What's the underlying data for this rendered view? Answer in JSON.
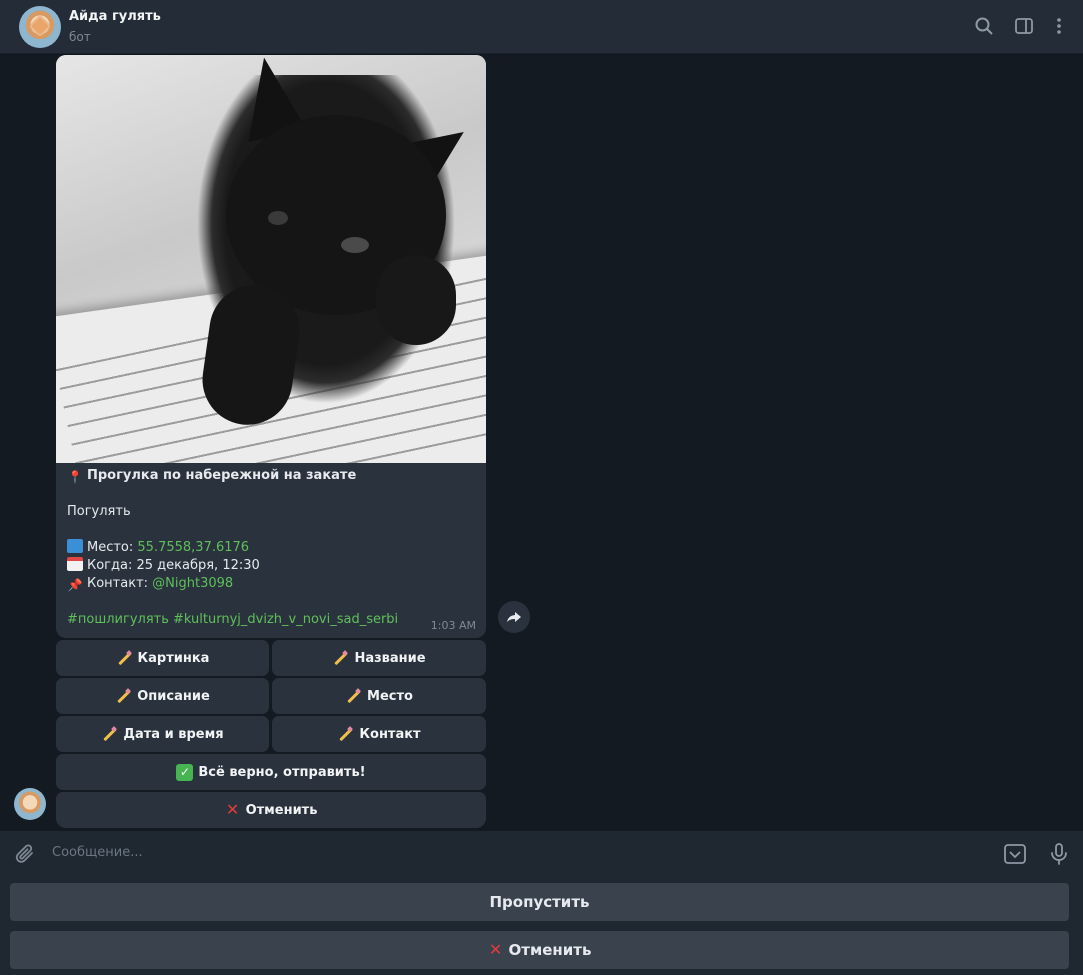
{
  "header": {
    "title": "Айда гулять",
    "subtitle": "бот"
  },
  "message": {
    "title": "Прогулка по набережной на закате",
    "description": "Погулять",
    "place_label": "Место: ",
    "place_value": "55.7558,37.6176",
    "when_label": "Когда: 25 декабря, 12:30",
    "contact_label": "Контакт: ",
    "contact_value": "@Night3098",
    "hashtags": "#пошлигулять #kulturnyj_dvizh_v_novi_sad_serbi",
    "time": "1:03 AM"
  },
  "inline_buttons": {
    "picture": "Картинка",
    "name": "Название",
    "description": "Описание",
    "place": "Место",
    "datetime": "Дата и время",
    "contact": "Контакт",
    "confirm": "Всё верно, отправить!",
    "cancel": "Отменить"
  },
  "composer": {
    "placeholder": "Сообщение..."
  },
  "keyboard": {
    "skip": "Пропустить",
    "cancel": "Отменить"
  },
  "colors": {
    "link": "#5fbf5a",
    "bubble": "#2a333d",
    "header": "#242d37"
  }
}
